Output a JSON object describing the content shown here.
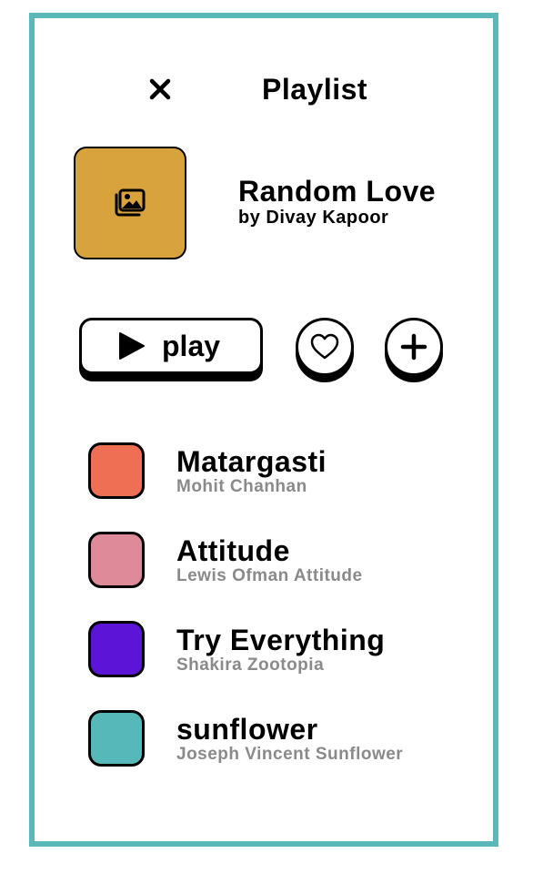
{
  "header": {
    "close_icon": "close-icon",
    "title": "Playlist"
  },
  "playlist": {
    "cover_icon": "image-gallery-icon",
    "cover_color": "#d8a23c",
    "name": "Random Love",
    "author": "by Divay Kapoor"
  },
  "actions": {
    "play_label": "play",
    "play_icon": "play-icon",
    "like_icon": "heart-icon",
    "add_icon": "plus-icon"
  },
  "songs": [
    {
      "title": "Matargasti",
      "artist": "Mohit Chanhan",
      "color": "#ef6f55"
    },
    {
      "title": "Attitude",
      "artist": "Lewis Ofman Attitude",
      "color": "#de8a98"
    },
    {
      "title": "Try Everything",
      "artist": "Shakira Zootopia",
      "color": "#5c14d6"
    },
    {
      "title": "sunflower",
      "artist": "Joseph Vincent Sunflower",
      "color": "#57b8b9"
    }
  ],
  "theme": {
    "frame_border": "#5ab8b8",
    "secondary_text": "#8a8a8a"
  }
}
